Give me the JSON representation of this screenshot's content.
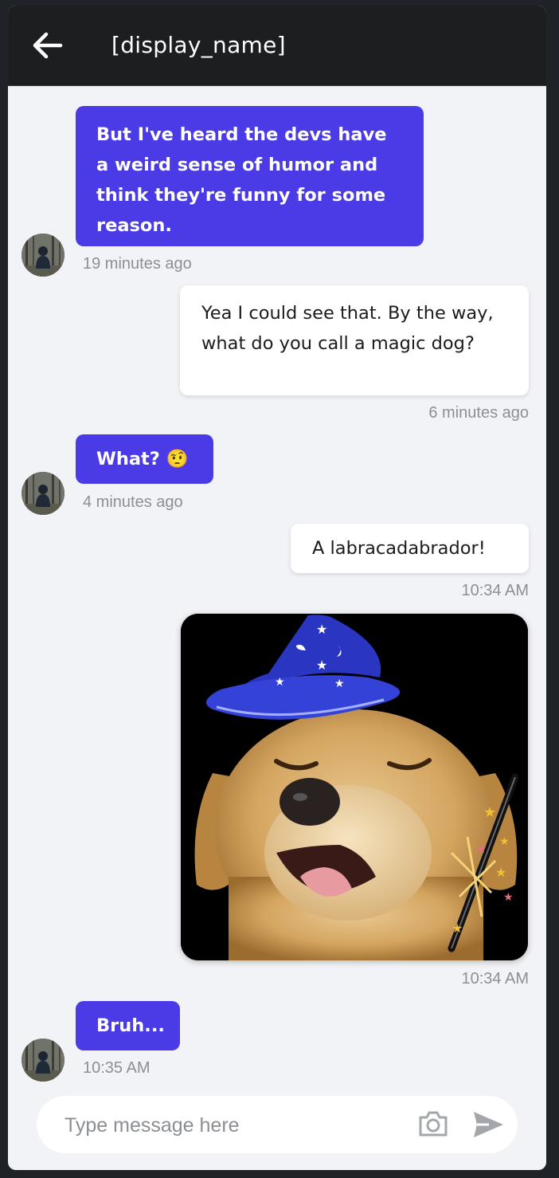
{
  "header": {
    "title": "[display_name]",
    "back_icon": "arrow-left-icon"
  },
  "messages": [
    {
      "direction": "incoming",
      "text": "But I've heard the devs have a weird sense of humor and think they're funny for some reason.",
      "time": "19 minutes ago"
    },
    {
      "direction": "outgoing",
      "text": "Yea I could see that. By the way, what do you call a magic dog?",
      "time": "6 minutes ago"
    },
    {
      "direction": "incoming",
      "text": "What? 🤨",
      "time": "4 minutes ago"
    },
    {
      "direction": "outgoing",
      "text": "A labracadabrador!",
      "time": "10:34 AM"
    },
    {
      "direction": "outgoing",
      "type": "image",
      "image": "smiling-dog-wizard-hat",
      "time": "10:34 AM"
    },
    {
      "direction": "incoming",
      "text": "Bruh...",
      "time": "10:35 AM"
    }
  ],
  "composer": {
    "placeholder": "Type message here",
    "camera_icon": "camera-icon",
    "send_icon": "send-icon"
  },
  "colors": {
    "incoming_bubble": "#4a3be6",
    "outgoing_bubble": "#ffffff",
    "header": "#1c1e20",
    "chat_background": "#f2f3f7"
  }
}
